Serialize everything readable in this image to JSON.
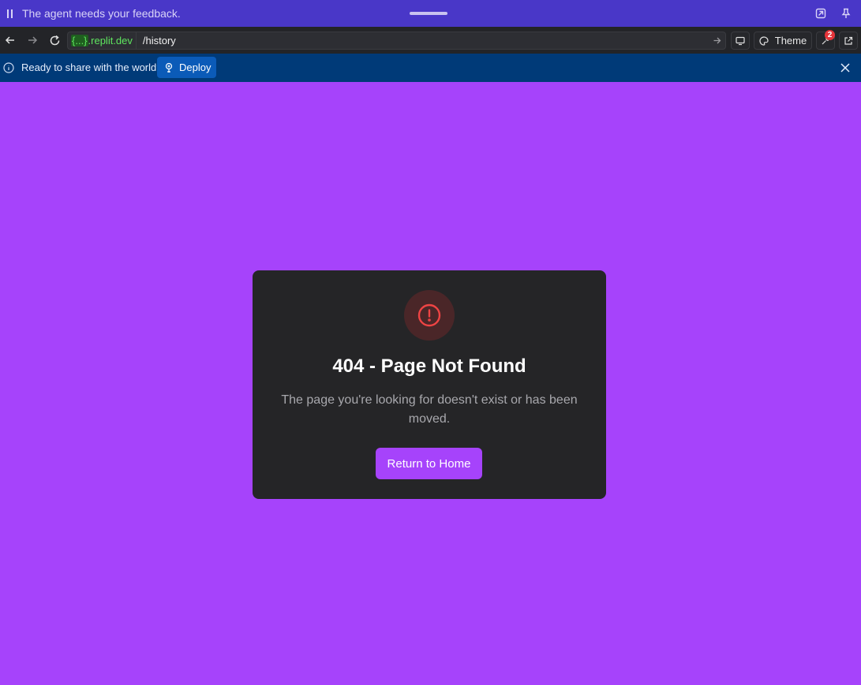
{
  "agent_bar": {
    "message": "The agent needs your feedback.",
    "background": "#4937c8"
  },
  "browser": {
    "host_braces": "{...}",
    "host_domain": ".replit.dev",
    "path": "/history",
    "theme_label": "Theme",
    "notification_count": "2"
  },
  "deploy_banner": {
    "text": "Ready to share with the world?",
    "deploy_label": "Deploy",
    "background": "#003a78"
  },
  "error_card": {
    "title": "404 - Page Not Found",
    "message": "The page you're looking for doesn't exist or has been moved.",
    "button_label": "Return to Home",
    "accent": "#a643fb",
    "icon": "alert-circle-icon"
  },
  "page_background": "#a643fb"
}
